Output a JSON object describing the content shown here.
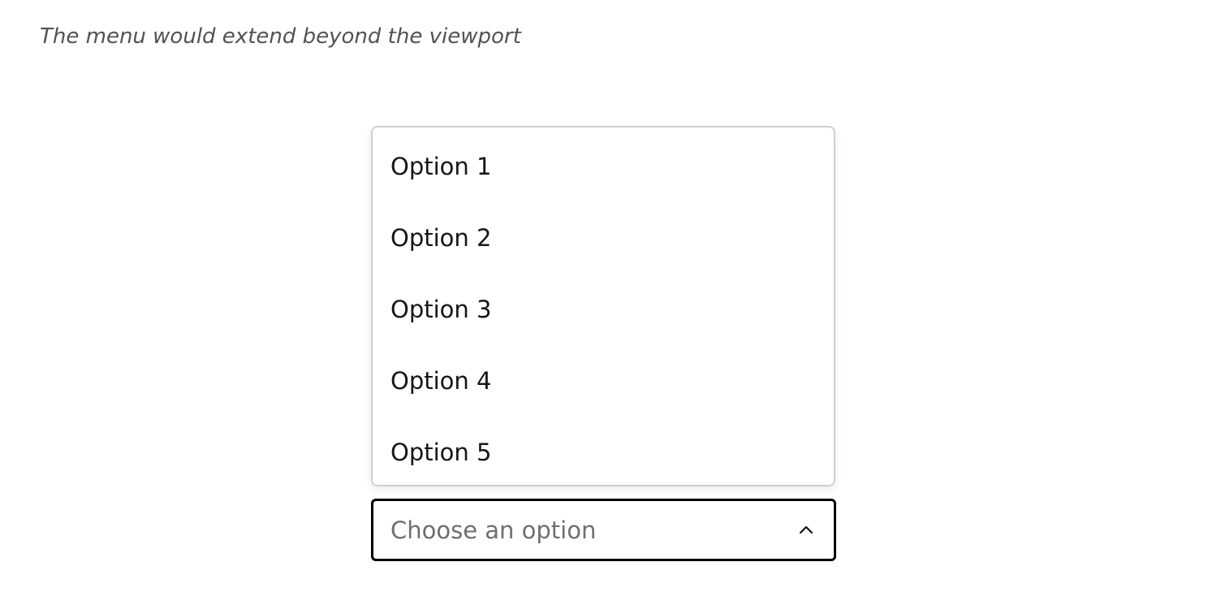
{
  "caption": "The menu would extend beyond the viewport",
  "menu": {
    "options": [
      {
        "label": "Option 1"
      },
      {
        "label": "Option 2"
      },
      {
        "label": "Option 3"
      },
      {
        "label": "Option 4"
      },
      {
        "label": "Option 5"
      }
    ]
  },
  "select": {
    "placeholder": "Choose an option",
    "icon": "chevron-up-icon",
    "expanded": true
  },
  "colors": {
    "text_primary": "#161616",
    "text_placeholder": "#6f6f6f",
    "caption": "#525252",
    "menu_border": "#d0d0d0",
    "select_border": "#000000"
  }
}
